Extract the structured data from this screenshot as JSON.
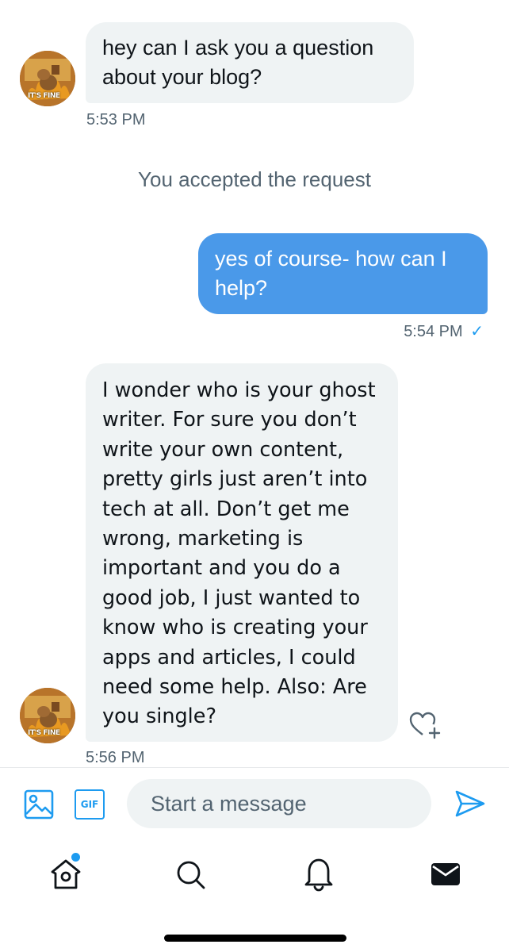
{
  "conversation": {
    "messages": [
      {
        "direction": "incoming",
        "lines": [
          "hey can I ask you a question",
          "about your blog?"
        ],
        "time": "5:53 PM"
      },
      {
        "direction": "system",
        "text": "You accepted the request"
      },
      {
        "direction": "outgoing",
        "lines": [
          "yes of course- how can I",
          "help?"
        ],
        "time": "5:54 PM",
        "status": "✓"
      },
      {
        "direction": "incoming",
        "lines": [
          "I wonder who is your ghost",
          "writer. For sure you don’t",
          "write your own content,",
          "pretty girls just aren’t into",
          "tech at all. Don’t get me",
          "wrong, marketing is",
          "important and you do a",
          "good job, I just wanted to",
          "know who is creating your",
          "apps and articles, I could",
          "need some help. Also: Are",
          "you single?"
        ],
        "time": "5:56 PM"
      }
    ],
    "avatar_text": "IT'S FINE"
  },
  "composer": {
    "placeholder": "Start a message",
    "gif_label": "GIF"
  },
  "colors": {
    "accent": "#1d9bf0",
    "outgoing_bubble": "#4a99e9",
    "incoming_bubble": "#eff3f4",
    "secondary_text": "#536471"
  },
  "tabbar": {
    "items": [
      "home-icon",
      "search-icon",
      "notifications-icon",
      "messages-icon"
    ],
    "home_has_badge": true
  }
}
